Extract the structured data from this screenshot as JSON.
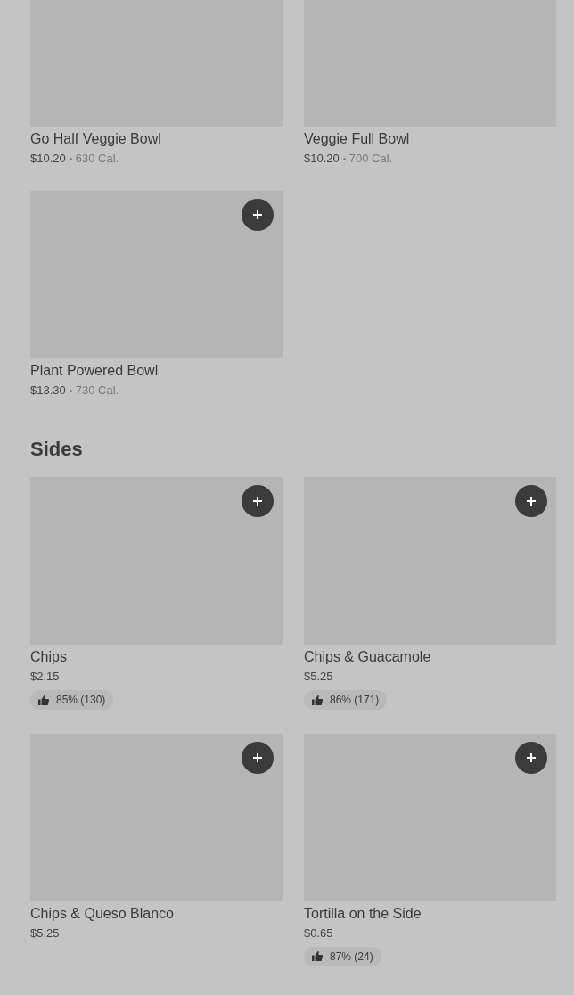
{
  "sections": [
    {
      "items": [
        {
          "name": "Go Half Veggie Bowl",
          "price": "$10.20",
          "calories": "630 Cal."
        },
        {
          "name": "Veggie Full Bowl",
          "price": "$10.20",
          "calories": "700 Cal."
        },
        {
          "name": "Plant Powered Bowl",
          "price": "$13.30",
          "calories": "730 Cal.",
          "add_button": true
        }
      ]
    },
    {
      "title": "Sides",
      "items": [
        {
          "name": "Chips",
          "price": "$2.15",
          "rating": "85% (130)",
          "add_button": true
        },
        {
          "name": "Chips & Guacamole",
          "price": "$5.25",
          "rating": "86% (171)",
          "add_button": true
        },
        {
          "name": "Chips & Queso Blanco",
          "price": "$5.25",
          "add_button": true
        },
        {
          "name": "Tortilla on the Side",
          "price": "$0.65",
          "rating": "87% (24)",
          "add_button": true
        }
      ]
    }
  ]
}
